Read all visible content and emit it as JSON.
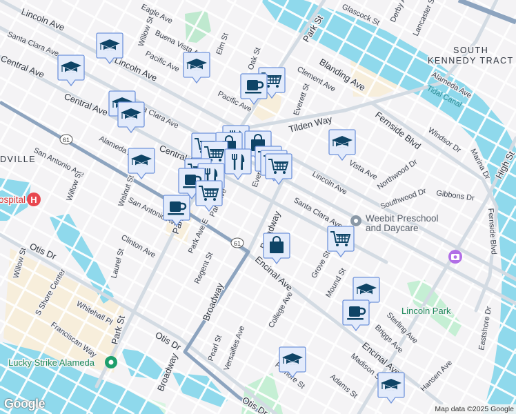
{
  "map": {
    "area_labels": [
      "SOUTH",
      "KENNEDY TRACT",
      "DVILLE"
    ],
    "water_labels": [
      "Tidal Canal"
    ],
    "park_labels": [
      "Lincoln Park"
    ],
    "route_shield": "61",
    "streets": [
      "Lincoln Ave",
      "Lincoln Ave",
      "Santa Clara Ave",
      "Central Ave",
      "Central Ave",
      "Central Ave",
      "Alameda Ave",
      "San Antonio Ave",
      "San Antonio Ave",
      "Willow St",
      "Willow St",
      "Walnut St",
      "Eagle Ave",
      "Buena Vista Ave",
      "Pacific Ave",
      "Pacific Ave",
      "Elm St",
      "Oak St",
      "Santa Clara Ave",
      "Park St",
      "Glascock St",
      "Derby Ave",
      "Lancaster St",
      "Blanding Ave",
      "Clement Ave",
      "Everett St",
      "Tilden Way",
      "Fernside Blvd",
      "Windsor Dr",
      "Marina Dr",
      "Alameda Ave",
      "Vista Ave",
      "Lincoln Ave",
      "Northwood Dr",
      "Gibbons Dr",
      "Southwood Dr",
      "High St",
      "Santa Clara Ave",
      "Fernside Blvd",
      "Broadway",
      "Encinal Ave",
      "Park Ave",
      "Park Ave E",
      "Regent St",
      "Clinton Ave",
      "Laurel St",
      "Otis Dr",
      "Willow St",
      "S Shore Center",
      "Whitehall Pl",
      "Franciscan Way",
      "Park St",
      "Otis Dr",
      "Broadway",
      "Broadway",
      "Pearl St",
      "Versailles Ave",
      "College Ave",
      "Grove St",
      "Mound St",
      "Sterling Ave",
      "Briggs Ave",
      "Encinal Ave",
      "Madison St",
      "Adams St",
      "Fillmore St",
      "Hansen Ave",
      "Eastshore Dr",
      "Otis Dr",
      "Park St",
      "Everett St"
    ]
  },
  "pois": {
    "preschool": [
      "Weebit Preschool",
      "and Daycare"
    ],
    "bowling": "Lucky Strike Alameda",
    "hospital": "Hospital",
    "hospital_visible": "spital",
    "hospital_glyph": "H"
  },
  "markers": {
    "types": [
      "school",
      "cafe",
      "grocery",
      "shopping",
      "restaurant"
    ],
    "colors": {
      "fill": "#e3ebfb",
      "border": "#6f93db",
      "icon": "#0e4466"
    }
  },
  "footer": {
    "logo": "Google",
    "attribution": "Map data ©2025 Google"
  }
}
